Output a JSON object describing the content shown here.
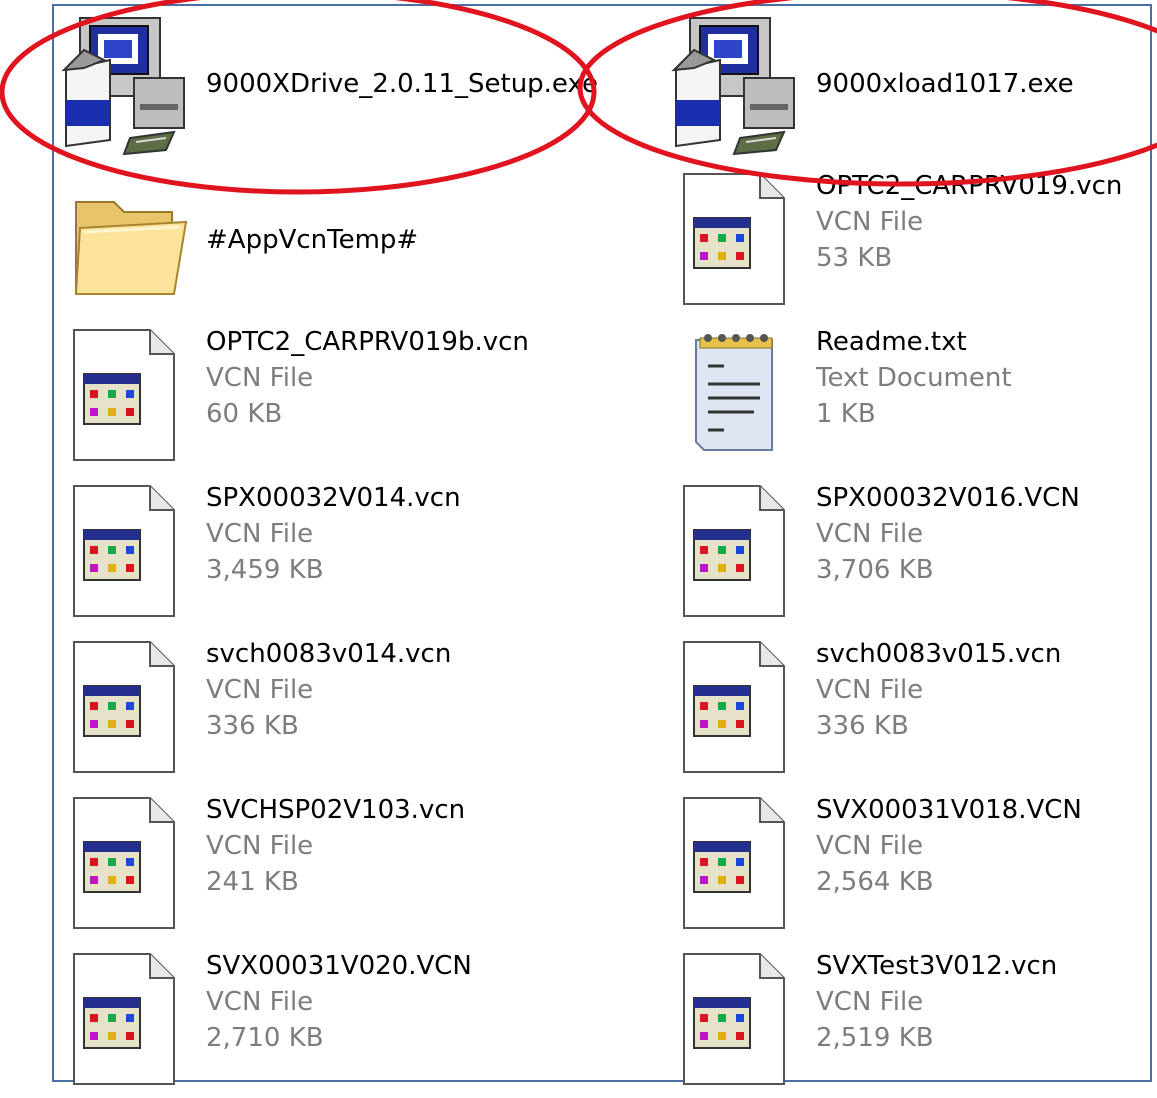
{
  "files": [
    {
      "name": "9000XDrive_2.0.11_Setup.exe",
      "kind": "installer"
    },
    {
      "name": "9000xload1017.exe",
      "kind": "installer"
    },
    {
      "name": "#AppVcnTemp#",
      "kind": "folder"
    },
    {
      "name": "OPTC2_CARPRV019.vcn",
      "type": "VCN File",
      "size": "53 KB",
      "kind": "vcn"
    },
    {
      "name": "OPTC2_CARPRV019b.vcn",
      "type": "VCN File",
      "size": "60 KB",
      "kind": "vcn"
    },
    {
      "name": "Readme.txt",
      "type": "Text Document",
      "size": "1 KB",
      "kind": "txt"
    },
    {
      "name": "SPX00032V014.vcn",
      "type": "VCN File",
      "size": "3,459 KB",
      "kind": "vcn"
    },
    {
      "name": "SPX00032V016.VCN",
      "type": "VCN File",
      "size": "3,706 KB",
      "kind": "vcn"
    },
    {
      "name": "svch0083v014.vcn",
      "type": "VCN File",
      "size": "336 KB",
      "kind": "vcn"
    },
    {
      "name": "svch0083v015.vcn",
      "type": "VCN File",
      "size": "336 KB",
      "kind": "vcn"
    },
    {
      "name": "SVCHSP02V103.vcn",
      "type": "VCN File",
      "size": "241 KB",
      "kind": "vcn"
    },
    {
      "name": "SVX00031V018.VCN",
      "type": "VCN File",
      "size": "2,564 KB",
      "kind": "vcn"
    },
    {
      "name": "SVX00031V020.VCN",
      "type": "VCN File",
      "size": "2,710 KB",
      "kind": "vcn"
    },
    {
      "name": "SVXTest3V012.vcn",
      "type": "VCN File",
      "size": "2,519 KB",
      "kind": "vcn"
    }
  ],
  "icons": {
    "installer": "setup-installer-icon",
    "folder": "folder-icon",
    "vcn": "vcn-file-icon",
    "txt": "text-document-icon"
  },
  "colors": {
    "frame_border": "#4a6fa5",
    "annotation_circle": "#e0141e",
    "secondary_text": "#7d7d7d"
  }
}
